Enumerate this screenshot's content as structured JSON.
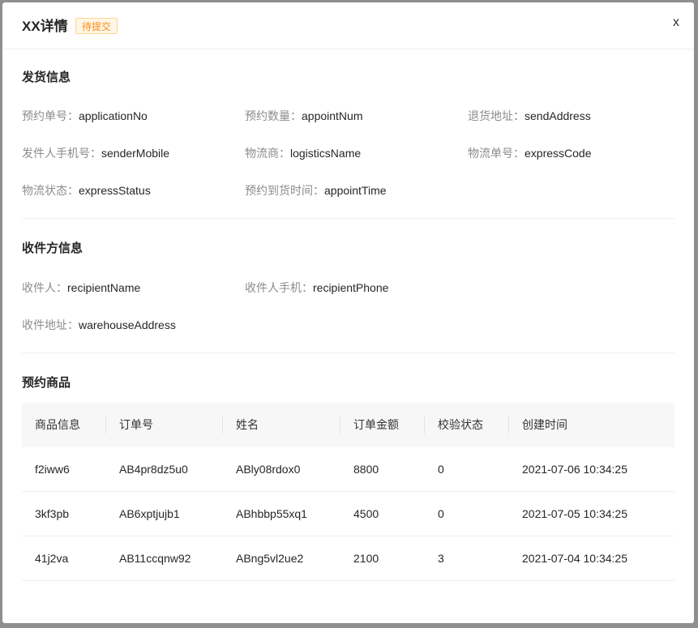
{
  "header": {
    "title": "XX详情",
    "status_tag": "待提交",
    "close_label": "x"
  },
  "shipping": {
    "section_title": "发货信息",
    "fields": [
      {
        "label": "预约单号：",
        "value": "applicationNo"
      },
      {
        "label": "预约数量：",
        "value": "appointNum"
      },
      {
        "label": "退货地址：",
        "value": "sendAddress"
      },
      {
        "label": "发件人手机号：",
        "value": "senderMobile"
      },
      {
        "label": "物流商：",
        "value": "logisticsName"
      },
      {
        "label": "物流单号：",
        "value": "expressCode"
      },
      {
        "label": "物流状态：",
        "value": "expressStatus"
      },
      {
        "label": "预约到货时间：",
        "value": "appointTime"
      }
    ]
  },
  "recipient": {
    "section_title": "收件方信息",
    "fields": [
      {
        "label": "收件人：",
        "value": "recipientName"
      },
      {
        "label": "收件人手机：",
        "value": "recipientPhone"
      },
      {
        "label": "收件地址：",
        "value": "warehouseAddress"
      }
    ]
  },
  "goods": {
    "section_title": "预约商品",
    "columns": [
      "商品信息",
      "订单号",
      "姓名",
      "订单金额",
      "校验状态",
      "创建时间"
    ],
    "rows": [
      [
        "f2iww6",
        "AB4pr8dz5u0",
        "ABly08rdox0",
        "8800",
        "0",
        "2021-07-06 10:34:25"
      ],
      [
        "3kf3pb",
        "AB6xptjujb1",
        "ABhbbp55xq1",
        "4500",
        "0",
        "2021-07-05 10:34:25"
      ],
      [
        "41j2va",
        "AB11ccqnw92",
        "ABng5vl2ue2",
        "2100",
        "3",
        "2021-07-04 10:34:25"
      ]
    ]
  }
}
